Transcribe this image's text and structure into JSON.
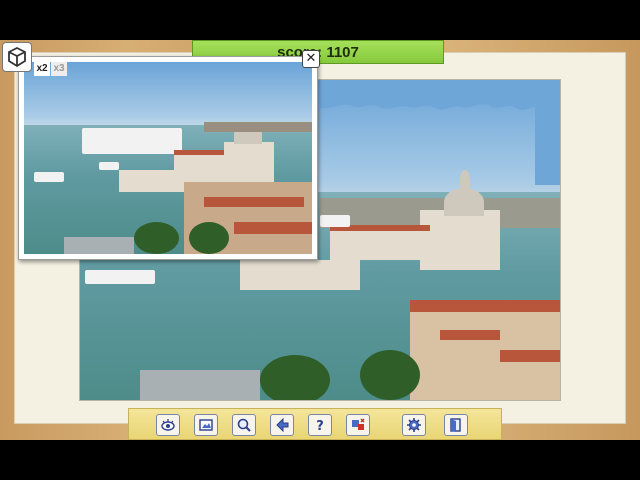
{
  "score": {
    "text": "score: 1107"
  },
  "preview": {
    "zoom_x2": "x2",
    "zoom_x3": "x3",
    "close": "✕"
  },
  "toolbar": {
    "tools": [
      {
        "name": "eye-icon"
      },
      {
        "name": "picture-icon"
      },
      {
        "name": "magnifier-icon"
      },
      {
        "name": "sort-pieces-icon"
      },
      {
        "name": "help-icon"
      },
      {
        "name": "shuffle-icon"
      },
      {
        "name": "settings-gear-icon"
      },
      {
        "name": "exit-door-icon"
      }
    ]
  },
  "colors": {
    "score_bar": "#8fd24a",
    "toolbar": "#efe08a",
    "board": "#f4f0e2"
  }
}
